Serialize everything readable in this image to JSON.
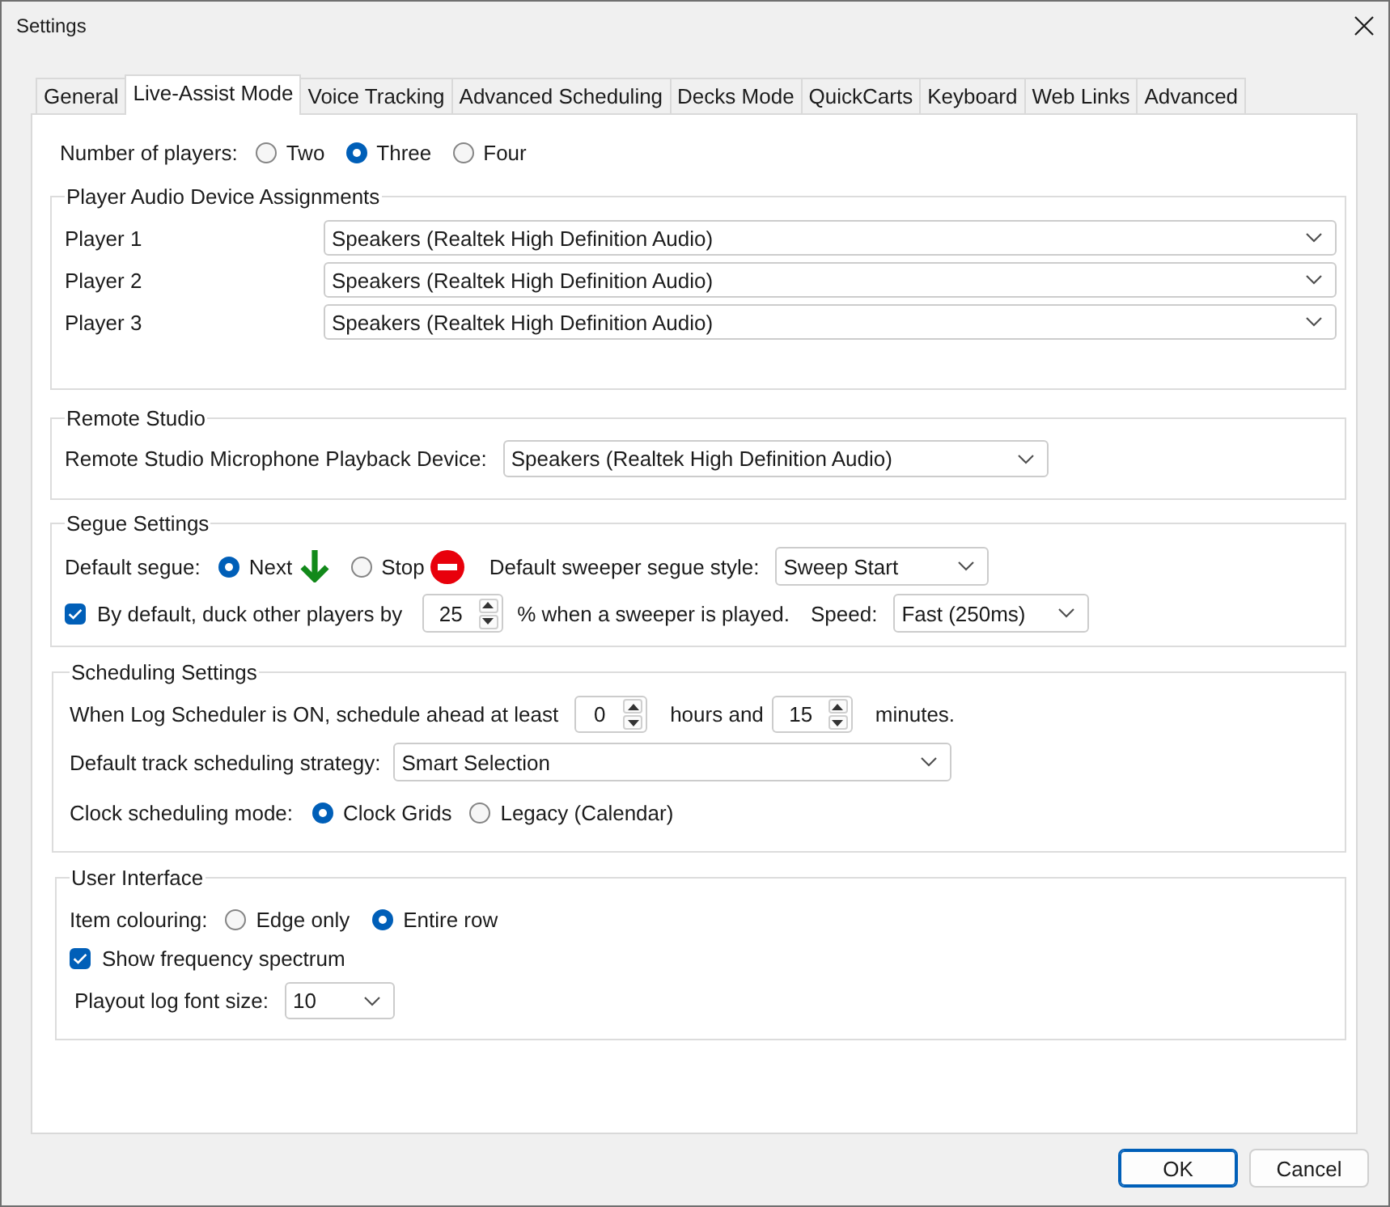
{
  "window": {
    "title": "Settings"
  },
  "tabs": [
    {
      "label": "General",
      "selected": false
    },
    {
      "label": "Live-Assist Mode",
      "selected": true
    },
    {
      "label": "Voice Tracking",
      "selected": false
    },
    {
      "label": "Advanced Scheduling",
      "selected": false
    },
    {
      "label": "Decks Mode",
      "selected": false
    },
    {
      "label": "QuickCarts",
      "selected": false
    },
    {
      "label": "Keyboard",
      "selected": false
    },
    {
      "label": "Web Links",
      "selected": false
    },
    {
      "label": "Advanced",
      "selected": false
    }
  ],
  "number_of_players": {
    "label": "Number of players:",
    "options": [
      {
        "label": "Two",
        "selected": false
      },
      {
        "label": "Three",
        "selected": true
      },
      {
        "label": "Four",
        "selected": false
      }
    ]
  },
  "player_audio_device_assignments": {
    "title": "Player Audio Device Assignments",
    "rows": [
      {
        "label": "Player 1",
        "value": "Speakers (Realtek High Definition Audio)"
      },
      {
        "label": "Player 2",
        "value": "Speakers (Realtek High Definition Audio)"
      },
      {
        "label": "Player 3",
        "value": "Speakers (Realtek High Definition Audio)"
      }
    ]
  },
  "remote_studio": {
    "title": "Remote Studio",
    "label": "Remote Studio Microphone Playback Device:",
    "value": "Speakers (Realtek High Definition Audio)"
  },
  "segue_settings": {
    "title": "Segue Settings",
    "segue_label": "Default segue:",
    "segue_options": [
      {
        "label": "Next",
        "selected": true,
        "kind": "next"
      },
      {
        "label": "Stop",
        "selected": false,
        "kind": "stop"
      }
    ],
    "style_label": "Default sweeper segue style:",
    "style_value": "Sweep Start",
    "duck": {
      "checked": true,
      "label": "By default, duck other players by",
      "value": "25",
      "suffix": "% when a sweeper is played."
    },
    "speed_label": "Speed:",
    "speed_value": "Fast (250ms)"
  },
  "scheduling_settings": {
    "title": "Scheduling Settings",
    "ahead_label": "When Log Scheduler is ON, schedule ahead at least",
    "hours_value": "0",
    "hours_label": "hours and",
    "minutes_value": "15",
    "minutes_label": "minutes.",
    "strategy_label": "Default track scheduling strategy:",
    "strategy_value": "Smart Selection",
    "clock_label": "Clock scheduling mode:",
    "clock_options": [
      {
        "label": "Clock Grids",
        "selected": true
      },
      {
        "label": "Legacy (Calendar)",
        "selected": false
      }
    ]
  },
  "user_interface": {
    "title": "User Interface",
    "colouring_label": "Item colouring:",
    "colouring_options": [
      {
        "label": "Edge only",
        "selected": false
      },
      {
        "label": "Entire row",
        "selected": true
      }
    ],
    "spectrum": {
      "checked": true,
      "label": "Show frequency spectrum"
    },
    "font_size_label": "Playout log font size:",
    "font_size_value": "10"
  },
  "buttons": [
    {
      "label": "OK",
      "default": true
    },
    {
      "label": "Cancel",
      "default": false
    }
  ]
}
